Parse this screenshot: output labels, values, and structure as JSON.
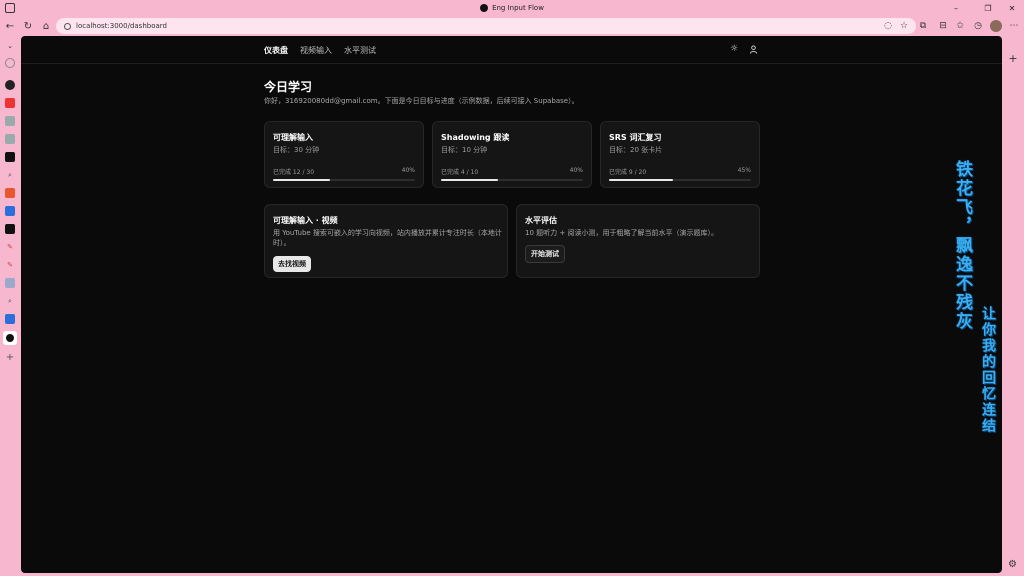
{
  "browser": {
    "tab_title": "Eng Input Flow",
    "url": "localhost:3000/dashboard",
    "window_controls": [
      "–",
      "❐",
      "✕"
    ]
  },
  "site_nav": {
    "links": [
      {
        "label": "仪表盘",
        "active": true
      },
      {
        "label": "视频输入",
        "active": false
      },
      {
        "label": "水平测试",
        "active": false
      }
    ],
    "icons": [
      "sun-icon",
      "user-icon"
    ]
  },
  "page": {
    "title": "今日学习",
    "subtitle": "你好，316920080dd@gmail.com。下面是今日目标与进度（示例数据，后续可接入 Supabase）。"
  },
  "goal_cards": [
    {
      "title": "可理解输入",
      "goal": "目标：30 分钟",
      "done": "已完成 12 / 30",
      "percent_label": "40%",
      "progress": 0.4
    },
    {
      "title": "Shadowing 跟读",
      "goal": "目标：10 分钟",
      "done": "已完成 4 / 10",
      "percent_label": "40%",
      "progress": 0.4
    },
    {
      "title": "SRS 词汇复习",
      "goal": "目标：20 张卡片",
      "done": "已完成 9 / 20",
      "percent_label": "45%",
      "progress": 0.45
    }
  ],
  "action_cards": [
    {
      "title": "可理解输入 · 视频",
      "desc_line1": "用 YouTube 搜索可嵌入的学习向视频，站内播放并累计专注时长（本地计",
      "desc_line2": "时）。",
      "button": "去找视频"
    },
    {
      "title": "水平评估",
      "desc_line1": "10 题听力 + 阅读小测，用于粗略了解当前水平（演示题库）。",
      "desc_line2": "",
      "button": "开始测试"
    }
  ],
  "overlay": {
    "calligraphy_line1": "铁花飞，飘逸不残灰",
    "calligraphy_line2": "让你我的回忆连结"
  },
  "colors": {
    "page_bg": "#0a0a0a",
    "card_bg": "#151515",
    "browser_frame": "#f7b8cf",
    "calligraphy": "#3aaef0"
  }
}
